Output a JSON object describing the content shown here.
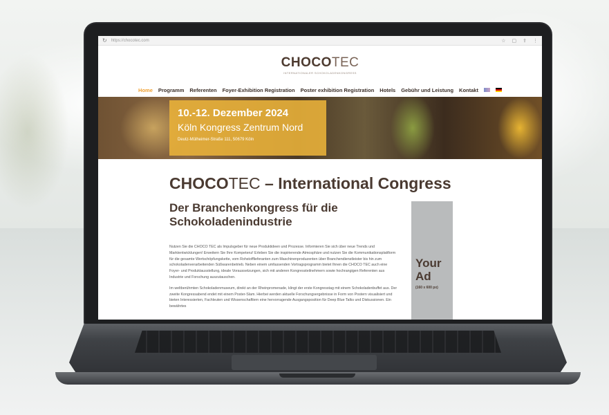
{
  "browser": {
    "url": "https://chocotec.com",
    "reload_icon": "reload-icon"
  },
  "logo": {
    "bold": "CHOCO",
    "light": "TEC",
    "subtitle": "INTERNATIONALER SCHOKOLADENKONGRESS"
  },
  "nav": {
    "items": [
      "Home",
      "Programm",
      "Referenten",
      "Foyer-Exhibition Registration",
      "Poster exhibition Registration",
      "Hotels",
      "Gebühr und Leistung",
      "Kontakt"
    ],
    "active_index": 0,
    "flags": [
      "english-flag",
      "german-flag"
    ]
  },
  "hero": {
    "date": "10.-12. Dezember 2024",
    "venue": "Köln Kongress Zentrum Nord",
    "address": "Deutz-Mülheimer-Straße 111, 50679 Köln"
  },
  "main": {
    "title_bold": "CHOCO",
    "title_light": "TEC",
    "title_rest": " – International Congress",
    "subtitle": "Der Branchenkongress für die Schokoladenindustrie",
    "paragraph1": "Nutzen Sie die CHOCO TEC als Impulsgeber für neue Produktideen und Prozesse. Informieren Sie sich über neue Trends und Marktentwicklungen! Erweitern Sie Ihre Kompetenz! Erleben Sie die inspirierende Atmosphäre und nutzen Sie die Kommunikationsplattform für die gesamte Wertschöpfungskette, vom Rohstofflieferanten zum Maschinenproduzenten über Branchendienstleister bis hin zum schokoladenverarbeitenden Süßwarenbetrieb. Neben einem umfassenden Vortragsprogramm bietet Ihnen die CHOCO TEC auch eine Foyer- und Produktausstellung, ideale Voraussetzungen, sich mit anderen Kongressteilnehmern sowie hochrangigen Referenten aus Industrie und Forschung auszutauschen.",
    "paragraph2": "Im weltberühmten Schokoladenmuseum, direkt an der Rheinpromenade, klingt der erste Kongresstag mit einem Schokoladenbuffet aus. Der zweite Kongressabend endet mit einem Poster-Slam. Hierbei werden aktuelle Forschungsergebnisse in Form von Postern visualisiert und bieten Interessierten, Fachleuten und Wissenschaftlern eine hervorragende Ausgangsposition für Deep Blue Talks und Diskussionen. Ein bewährtes"
  },
  "ad": {
    "title": "Your Ad",
    "size": "(160 x 600 px)"
  }
}
